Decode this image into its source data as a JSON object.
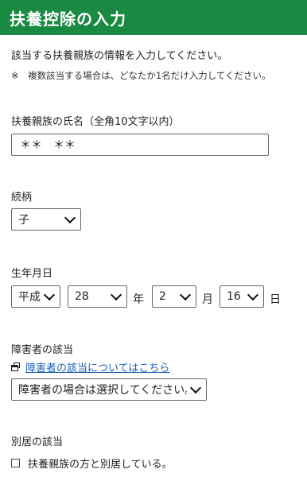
{
  "header": {
    "title": "扶養控除の入力"
  },
  "intro": {
    "text": "該当する扶養親族の情報を入力してください。",
    "note": "※　複数該当する場合は、どなたか1名だけ入力してください。"
  },
  "name_field": {
    "label": "扶養親族の氏名（全角10文字以内）",
    "value": "＊＊　＊＊"
  },
  "relationship": {
    "label": "続柄",
    "value": "子"
  },
  "birthdate": {
    "label": "生年月日",
    "era": "平成",
    "year": "28",
    "year_unit": "年",
    "month": "2",
    "month_unit": "月",
    "day": "16",
    "day_unit": "日"
  },
  "disability": {
    "label": "障害者の該当",
    "link_text": "障害者の該当についてはこちら",
    "select_value": "障害者の場合は選択してください。"
  },
  "separate_residence": {
    "label": "別居の該当",
    "checkbox_label": "扶養親族の方と別居している。",
    "checked": false
  },
  "icons": {
    "dropdown": "chevron-down-icon",
    "link": "new-window-icon"
  },
  "colors": {
    "header_bg": "#1a8a43",
    "link": "#1a5fb4"
  }
}
